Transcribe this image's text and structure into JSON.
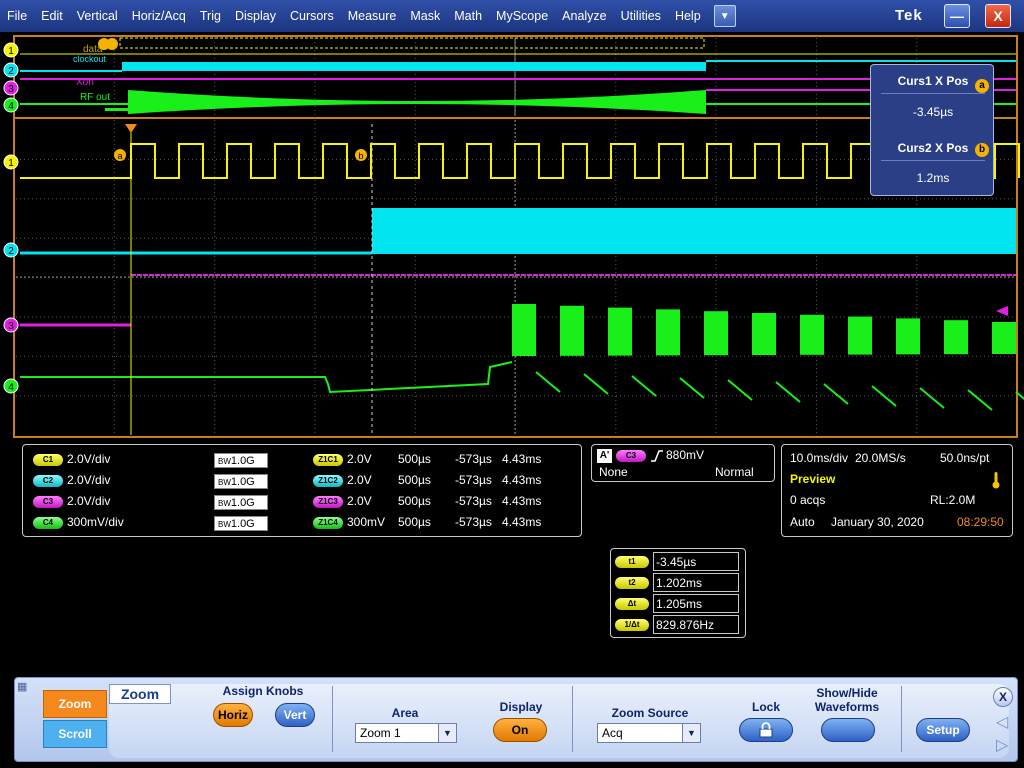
{
  "menu": [
    "File",
    "Edit",
    "Vertical",
    "Horiz/Acq",
    "Trig",
    "Display",
    "Cursors",
    "Measure",
    "Mask",
    "Math",
    "MyScope",
    "Analyze",
    "Utilities",
    "Help"
  ],
  "brand": "Tek",
  "window": {
    "minimize_icon": "minimize-icon",
    "close_label": "X"
  },
  "colors": {
    "ch1": "#f5f500",
    "ch2": "#00e5f0",
    "ch3": "#e020e0",
    "ch4": "#19f019",
    "grid": "#5a5a5a",
    "frame": "#c8801e",
    "panel": "#2a3f86"
  },
  "overview": {
    "labels": {
      "data": "data",
      "clock": "clockout",
      "xon": "Xon",
      "rf": "RF out"
    }
  },
  "markers": {
    "ch": [
      "1",
      "2",
      "3",
      "4"
    ],
    "cursor_a": "a",
    "cursor_b": "b"
  },
  "cursor_overlay": {
    "curs1_label": "Curs1 X Pos",
    "curs1_value": "-3.45µs",
    "curs1_badge": "a",
    "curs2_label": "Curs2 X Pos",
    "curs2_value": "1.2ms",
    "curs2_badge": "b"
  },
  "channels": [
    {
      "badge": "C1",
      "scale": "2.0V/div",
      "bw": "1.0G",
      "zbadge": "Z1C1",
      "zscale": "2.0V",
      "ztime": "500µs",
      "zpos": "-573µs",
      "zrange": "4.43ms"
    },
    {
      "badge": "C2",
      "scale": "2.0V/div",
      "bw": "1.0G",
      "zbadge": "Z1C2",
      "zscale": "2.0V",
      "ztime": "500µs",
      "zpos": "-573µs",
      "zrange": "4.43ms"
    },
    {
      "badge": "C3",
      "scale": "2.0V/div",
      "bw": "1.0G",
      "zbadge": "Z1C3",
      "zscale": "2.0V",
      "ztime": "500µs",
      "zpos": "-573µs",
      "zrange": "4.43ms"
    },
    {
      "badge": "C4",
      "scale": "300mV/div",
      "bw": "1.0G",
      "zbadge": "Z1C4",
      "zscale": "300mV",
      "ztime": "500µs",
      "zpos": "-573µs",
      "zrange": "4.43ms"
    }
  ],
  "bw_prefix": "BW",
  "trigger": {
    "a_label": "A'",
    "channel": "C3",
    "level": "880mV",
    "coupling": "None",
    "mode": "Normal"
  },
  "acquisition": {
    "horiz": "10.0ms/div",
    "rate": "20.0MS/s",
    "res": "50.0ns/pt",
    "state": "Preview",
    "acqs": "0 acqs",
    "rl": "RL:2.0M",
    "mode": "Auto",
    "date": "January 30, 2020",
    "time": "08:29:50"
  },
  "cursor_readout": [
    {
      "badge": "t1",
      "value": "-3.45µs"
    },
    {
      "badge": "t2",
      "value": "1.202ms"
    },
    {
      "badge": "Δt",
      "value": "1.205ms"
    },
    {
      "badge": "1/Δt",
      "value": "829.876Hz"
    }
  ],
  "controls": {
    "zoom_label": "Zoom",
    "scroll_label": "Scroll",
    "tab_label": "Zoom",
    "assign_knobs": "Assign Knobs",
    "horiz": "Horiz",
    "vert": "Vert",
    "area_label": "Area",
    "area_value": "Zoom 1",
    "display_label": "Display",
    "display_value": "On",
    "zoom_source_label": "Zoom Source",
    "zoom_source_value": "Acq",
    "lock_label": "Lock",
    "show_hide_label": "Show/Hide Waveforms",
    "setup_label": "Setup",
    "close_label": "X"
  }
}
